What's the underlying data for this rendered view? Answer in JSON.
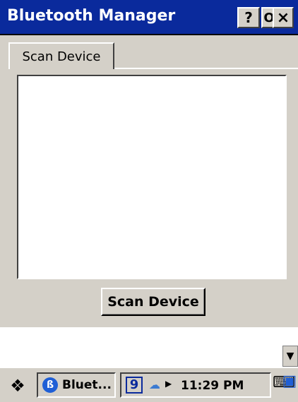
{
  "window": {
    "title": "Bluetooth Manager",
    "help_label": "?",
    "ok_label": "OK",
    "close_label": "×"
  },
  "tabs": [
    {
      "label": "Scan Device"
    }
  ],
  "actions": {
    "scan_label": "Scan Device"
  },
  "taskbar": {
    "task_label": "Bluet...",
    "tray_badge": "9",
    "time": "11:29 PM"
  },
  "icons": {
    "start": "start-menu-icon",
    "bluetooth": "bluetooth-icon",
    "network": "network-icon",
    "keyboard": "keyboard-icon",
    "desktop": "desktop-icon"
  }
}
